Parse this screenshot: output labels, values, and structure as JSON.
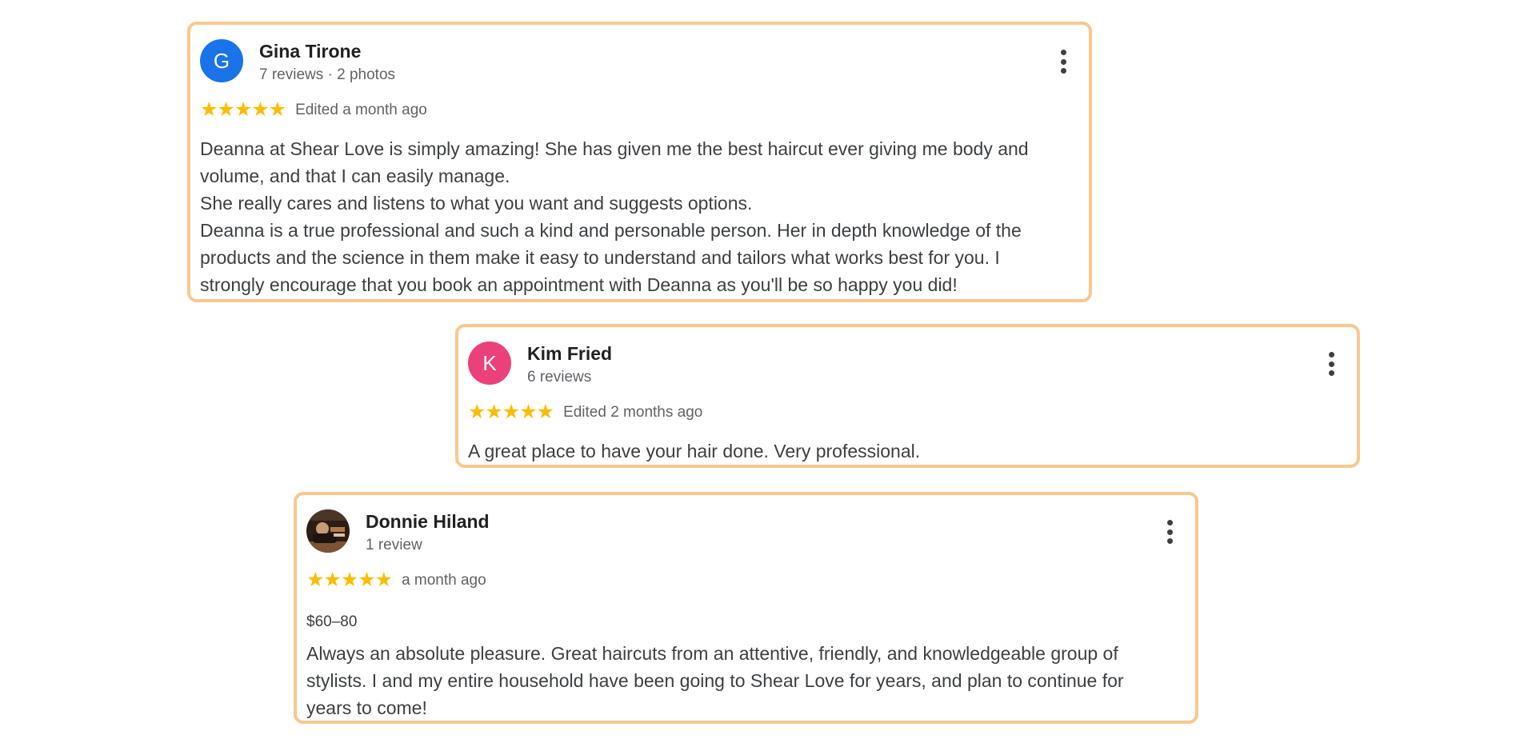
{
  "reviews": [
    {
      "author": "Gina Tirone",
      "avatar_letter": "G",
      "avatar_color": "#1a73e8",
      "meta": "7 reviews · 2 photos",
      "stars": "★★★★★",
      "rating": 5,
      "date": "Edited a month ago",
      "paragraphs": [
        "Deanna at Shear Love is simply amazing! She has given me the best haircut ever giving me body and volume, and that I can easily manage.",
        "She really cares and listens to what you want and suggests options.",
        "Deanna is a true professional and such a kind and personable person. Her in depth knowledge of the products and the science in them make it easy to understand and tailors what works best for you. I strongly encourage that you book an appointment with Deanna as you'll be so happy you did!"
      ]
    },
    {
      "author": "Kim Fried",
      "avatar_letter": "K",
      "avatar_color": "#ec407a",
      "meta": "6 reviews",
      "stars": "★★★★★",
      "rating": 5,
      "date": "Edited 2 months ago",
      "paragraphs": [
        "A great place to have your hair done. Very professional."
      ]
    },
    {
      "author": "Donnie Hiland",
      "avatar_icon": "profile-photo",
      "meta": "1 review",
      "stars": "★★★★★",
      "rating": 5,
      "date": "a month ago",
      "price": "$60–80",
      "paragraphs": [
        "Always an absolute pleasure. Great haircuts from an attentive, friendly, and knowledgeable group of stylists. I and my entire household have been going to Shear Love for years, and plan to continue for years to come!"
      ]
    }
  ],
  "colors": {
    "card_border": "#f9c88f",
    "star": "#fbbc04",
    "muted_text": "#5f6368"
  }
}
